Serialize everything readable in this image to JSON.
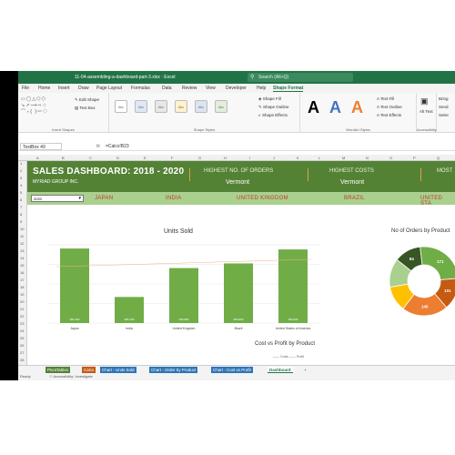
{
  "window": {
    "title": "11-04-assembling-a-dashboard-part-3.xlsx  ·  Excel",
    "search_placeholder": "Search (Alt+Q)"
  },
  "menu": [
    "File",
    "Home",
    "Insert",
    "Draw",
    "Page Layout",
    "Formulas",
    "Data",
    "Review",
    "View",
    "Developer",
    "Help",
    "Shape Format"
  ],
  "menu_active": "Shape Format",
  "ribbon": {
    "insert_shapes_label": "Insert Shapes",
    "edit_shape": "Edit Shape",
    "text_box": "Text Box",
    "shape_styles_label": "Shape Styles",
    "style_abc": "Abc",
    "shape_fill": "Shape Fill",
    "shape_outline": "Shape Outline",
    "shape_effects": "Shape Effects",
    "wordart_label": "WordArt Styles",
    "wordart_a": "A",
    "text_fill": "Text Fill",
    "text_outline": "Text Outline",
    "text_effects": "Text Effects",
    "alt_text": "Alt Text",
    "accessibility_label": "Accessibility",
    "bring_forward": "Bring",
    "send_backward": "Send",
    "selection": "Selec"
  },
  "formula_bar": {
    "name_box": "TextBox 49",
    "fx": "fx",
    "formula": "=Calcs!B23"
  },
  "columns": [
    "A",
    "B",
    "C",
    "D",
    "E",
    "F",
    "G",
    "H",
    "I",
    "J",
    "K",
    "L",
    "M",
    "N",
    "O",
    "P",
    "Q"
  ],
  "rows": [
    "1",
    "2",
    "3",
    "4",
    "5",
    "6",
    "7",
    "8",
    "9",
    "10",
    "11",
    "12",
    "13",
    "14",
    "15",
    "16",
    "17",
    "18",
    "19",
    "20",
    "21",
    "22",
    "23",
    "24",
    "25",
    "26",
    "27",
    "28"
  ],
  "dashboard": {
    "title": "SALES DASHBOARD: 2018 - 2020",
    "company": "MYRIAD GROUP INC.",
    "kpis": [
      {
        "label": "HIGHEST NO. OF ORDERS",
        "value": "Vermont"
      },
      {
        "label": "HIGHEST COSTS",
        "value": "Vermont"
      },
      {
        "label": "MOST",
        "value": ""
      }
    ],
    "year_select": "2020",
    "countries": [
      "JAPAN",
      "INDIA",
      "UNITED KINGDOM",
      "BRAZIL",
      "UNITED STA"
    ]
  },
  "charts": {
    "units_title": "Units Sold",
    "orders_title": "No of Orders by Product",
    "cvp_title": "Cost vs Profit by Product",
    "cvp_legend": "—— Costs   —— Profit"
  },
  "chart_data": [
    {
      "type": "bar",
      "title": "Units Sold",
      "categories": [
        "Japan",
        "India",
        "United Kingdom",
        "Brazil",
        "United States of America"
      ],
      "values": [
        400,
        140,
        295,
        320,
        395
      ],
      "data_labels": [
        "381,300",
        "285,100",
        "265,890",
        "286,800",
        "282,600"
      ],
      "xlabel": "",
      "ylabel": "",
      "ylim": [
        0,
        420
      ],
      "grid": true,
      "color": "#70ad47"
    },
    {
      "type": "pie",
      "title": "No of Orders by Product",
      "labels": [
        "84",
        "171",
        "101",
        "145"
      ],
      "values": [
        84,
        171,
        101,
        145,
        80,
        90
      ],
      "colors": [
        "#375623",
        "#70ad47",
        "#c55a11",
        "#ed7d31",
        "#ffc000",
        "#a9d08e"
      ],
      "donut": true
    }
  ],
  "sheet_tabs": [
    "PivotTables",
    "Calcs",
    "Chart - Units Sold",
    "Chart - Order by Product",
    "Chart - Cost vs Profit",
    "Dashboard"
  ],
  "sheet_tab_colors": [
    "#548235",
    "#c55a11",
    "#2e75b6",
    "#2e75b6",
    "#2e75b6",
    "#217346"
  ],
  "active_tab": "Dashboard",
  "add_sheet": "+",
  "status": {
    "ready": "Ready",
    "accessibility": "Accessibility: Investigate"
  }
}
